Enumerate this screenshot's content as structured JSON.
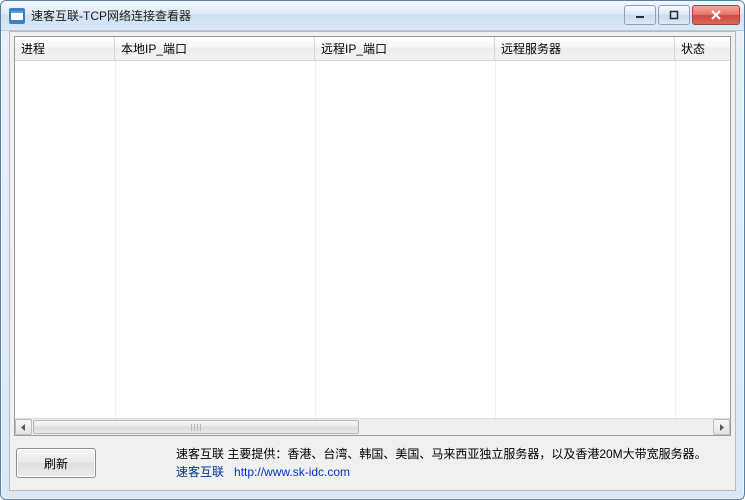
{
  "window": {
    "title": "速客互联-TCP网络连接查看器"
  },
  "columns": {
    "process": "进程",
    "local": "本地IP_端口",
    "remote": "远程IP_端口",
    "server": "远程服务器",
    "state": "状态"
  },
  "rows": [],
  "buttons": {
    "refresh": "刷新"
  },
  "footer": {
    "line1": "速客互联 主要提供：香港、台湾、韩国、美国、马来西亚独立服务器，以及香港20M大带宽服务器。",
    "link_name": "速客互联",
    "link_url": "http://www.sk-idc.com"
  }
}
